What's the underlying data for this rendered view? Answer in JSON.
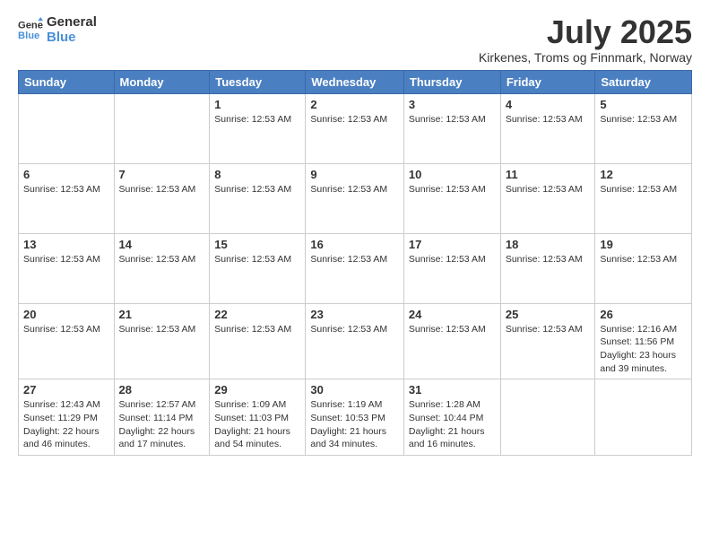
{
  "logo": {
    "line1": "General",
    "line2": "Blue"
  },
  "title": "July 2025",
  "location": "Kirkenes, Troms og Finnmark, Norway",
  "header_days": [
    "Sunday",
    "Monday",
    "Tuesday",
    "Wednesday",
    "Thursday",
    "Friday",
    "Saturday"
  ],
  "weeks": [
    [
      {
        "day": "",
        "info": ""
      },
      {
        "day": "",
        "info": ""
      },
      {
        "day": "1",
        "info": "Sunrise: 12:53 AM"
      },
      {
        "day": "2",
        "info": "Sunrise: 12:53 AM"
      },
      {
        "day": "3",
        "info": "Sunrise: 12:53 AM"
      },
      {
        "day": "4",
        "info": "Sunrise: 12:53 AM"
      },
      {
        "day": "5",
        "info": "Sunrise: 12:53 AM"
      }
    ],
    [
      {
        "day": "6",
        "info": "Sunrise: 12:53 AM"
      },
      {
        "day": "7",
        "info": "Sunrise: 12:53 AM"
      },
      {
        "day": "8",
        "info": "Sunrise: 12:53 AM"
      },
      {
        "day": "9",
        "info": "Sunrise: 12:53 AM"
      },
      {
        "day": "10",
        "info": "Sunrise: 12:53 AM"
      },
      {
        "day": "11",
        "info": "Sunrise: 12:53 AM"
      },
      {
        "day": "12",
        "info": "Sunrise: 12:53 AM"
      }
    ],
    [
      {
        "day": "13",
        "info": "Sunrise: 12:53 AM"
      },
      {
        "day": "14",
        "info": "Sunrise: 12:53 AM"
      },
      {
        "day": "15",
        "info": "Sunrise: 12:53 AM"
      },
      {
        "day": "16",
        "info": "Sunrise: 12:53 AM"
      },
      {
        "day": "17",
        "info": "Sunrise: 12:53 AM"
      },
      {
        "day": "18",
        "info": "Sunrise: 12:53 AM"
      },
      {
        "day": "19",
        "info": "Sunrise: 12:53 AM"
      }
    ],
    [
      {
        "day": "20",
        "info": "Sunrise: 12:53 AM"
      },
      {
        "day": "21",
        "info": "Sunrise: 12:53 AM"
      },
      {
        "day": "22",
        "info": "Sunrise: 12:53 AM"
      },
      {
        "day": "23",
        "info": "Sunrise: 12:53 AM"
      },
      {
        "day": "24",
        "info": "Sunrise: 12:53 AM"
      },
      {
        "day": "25",
        "info": "Sunrise: 12:53 AM"
      },
      {
        "day": "26",
        "info": "Sunrise: 12:16 AM\nSunset: 11:56 PM\nDaylight: 23 hours and 39 minutes."
      }
    ],
    [
      {
        "day": "27",
        "info": "Sunrise: 12:43 AM\nSunset: 11:29 PM\nDaylight: 22 hours and 46 minutes."
      },
      {
        "day": "28",
        "info": "Sunrise: 12:57 AM\nSunset: 11:14 PM\nDaylight: 22 hours and 17 minutes."
      },
      {
        "day": "29",
        "info": "Sunrise: 1:09 AM\nSunset: 11:03 PM\nDaylight: 21 hours and 54 minutes."
      },
      {
        "day": "30",
        "info": "Sunrise: 1:19 AM\nSunset: 10:53 PM\nDaylight: 21 hours and 34 minutes."
      },
      {
        "day": "31",
        "info": "Sunrise: 1:28 AM\nSunset: 10:44 PM\nDaylight: 21 hours and 16 minutes."
      },
      {
        "day": "",
        "info": ""
      },
      {
        "day": "",
        "info": ""
      }
    ]
  ]
}
